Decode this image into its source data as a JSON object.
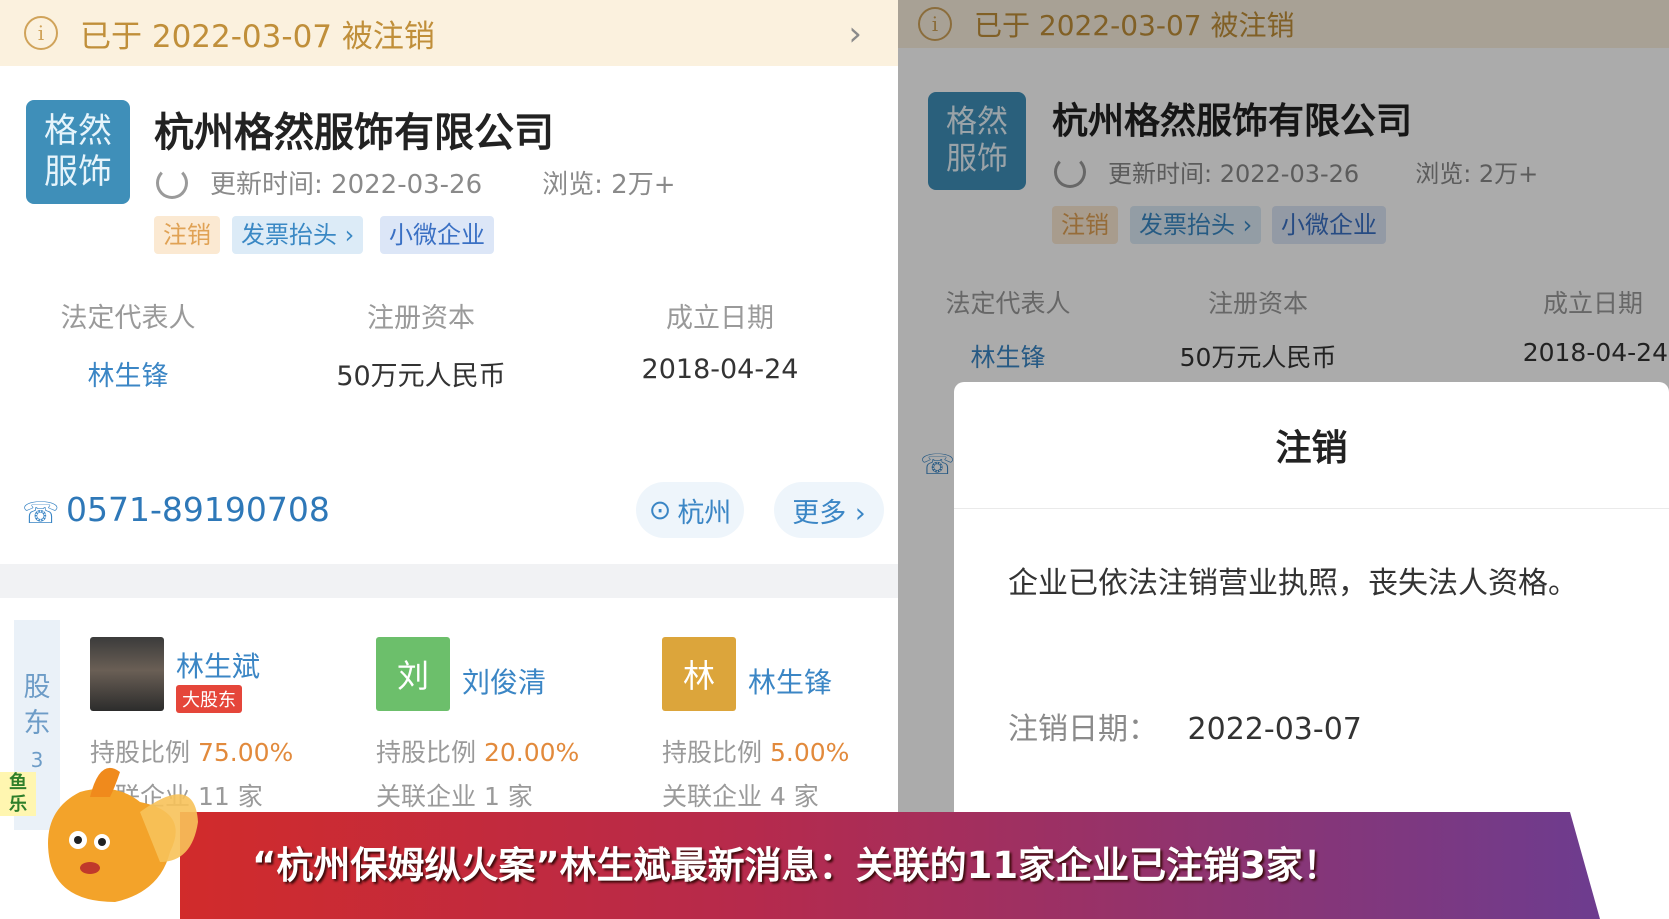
{
  "notice": {
    "text": "已于 2022-03-07 被注销"
  },
  "company": {
    "logo_line1": "格然",
    "logo_line2": "服饰",
    "name": "杭州格然服饰有限公司",
    "update_label": "更新时间: 2022-03-26",
    "views_label": "浏览: 2万+",
    "tags": [
      "注销",
      "发票抬头 ›",
      "小微企业"
    ]
  },
  "info": {
    "legal_rep_label": "法定代表人",
    "legal_rep_value": "林生锋",
    "capital_label": "注册资本",
    "capital_value": "50万元人民币",
    "founded_label": "成立日期",
    "founded_value": "2018-04-24"
  },
  "contact": {
    "phone": "0571-89190708",
    "city": "杭州",
    "more": "更多 ›"
  },
  "shareholders": {
    "side_label_1": "股",
    "side_label_2": "东",
    "count": "3",
    "items": [
      {
        "avatar": "",
        "name": "林生斌",
        "badge": "大股东",
        "ratio_label": "持股比例",
        "ratio": "75.00%",
        "related": "关联企业 11 家"
      },
      {
        "avatar": "刘",
        "name": "刘俊清",
        "badge": "",
        "ratio_label": "持股比例",
        "ratio": "20.00%",
        "related": "关联企业 1 家"
      },
      {
        "avatar": "林",
        "name": "林生锋",
        "badge": "",
        "ratio_label": "持股比例",
        "ratio": "5.00%",
        "related": "关联企业 4 家"
      }
    ]
  },
  "modal": {
    "title": "注销",
    "body": "企业已依法注销营业执照，丧失法人资格。",
    "date_label": "注销日期：",
    "date_value": "2022-03-07"
  },
  "banner": {
    "text": "“杭州保姆纵火案”林生斌最新消息：关联的11家企业已注销3家！"
  },
  "watermark": {
    "line1": "鱼",
    "line2": "乐"
  },
  "colors": {
    "accent": "#3b86c5",
    "notice_bg": "#fbf1de",
    "banner_red": "#d12b2b",
    "banner_purple": "#6d3c8f"
  }
}
